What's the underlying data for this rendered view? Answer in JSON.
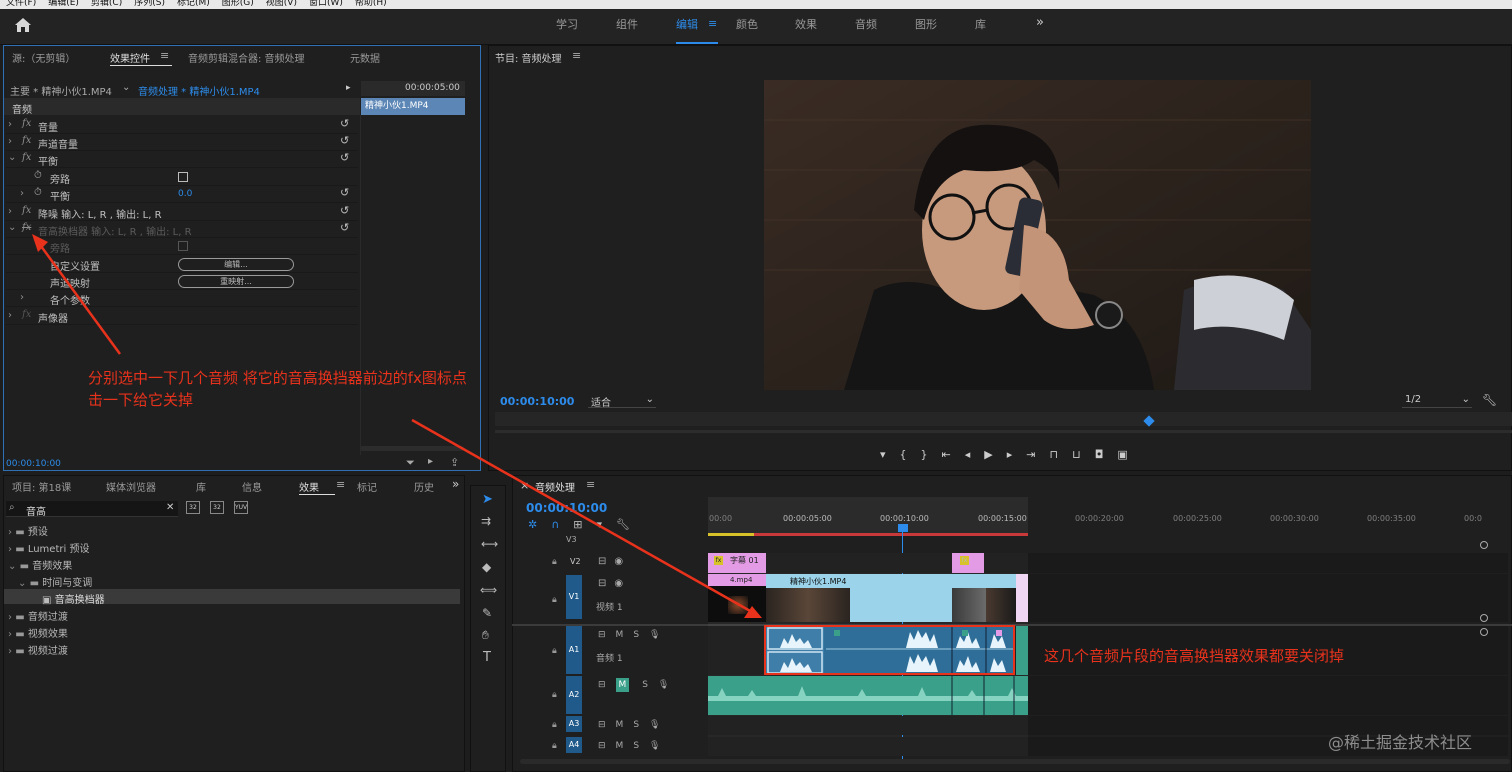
{
  "menu": [
    "文件(F)",
    "编辑(E)",
    "剪辑(C)",
    "序列(S)",
    "标记(M)",
    "图形(G)",
    "视图(V)",
    "窗口(W)",
    "帮助(H)"
  ],
  "workspaces": [
    "学习",
    "组件",
    "编辑",
    "颜色",
    "效果",
    "音频",
    "图形",
    "库"
  ],
  "active_workspace": "编辑",
  "source_panel": {
    "tabs": [
      "源:（无剪辑）",
      "效果控件",
      "音频剪辑混合器: 音频处理",
      "元数据"
    ],
    "clip_main": "主要 * 精神小伙1.MP4",
    "clip_seq": "音频处理 * 精神小伙1.MP4",
    "mini_time": "00:00:05:00",
    "mini_clip": "精神小伙1.MP4",
    "section": "音频",
    "rows": [
      {
        "fx": true,
        "label": "音量"
      },
      {
        "fx": true,
        "label": "声道音量"
      },
      {
        "fx": true,
        "label": "平衡"
      },
      {
        "label": "旁路"
      },
      {
        "label": "平衡",
        "value": "0.0"
      },
      {
        "fx": true,
        "label": "降噪 输入: L, R , 输出: L, R"
      },
      {
        "fx": true,
        "label": "音高换档器 输入: L, R , 输出: L, R"
      },
      {
        "label": "旁路"
      },
      {
        "label": "自定义设置",
        "button": "编辑..."
      },
      {
        "label": "声道映射",
        "button": "重映射..."
      },
      {
        "label": "各个参数"
      },
      {
        "fx": true,
        "label": "声像器"
      }
    ],
    "footer_time": "00:00:10:00"
  },
  "annotation1": "分别选中一下几个音频 将它的音高换挡器前边的fx图标点击一下给它关掉",
  "annotation2": "这几个音频片段的音高换挡器效果都要关闭掉",
  "program": {
    "title": "节目: 音频处理",
    "time": "00:00:10:00",
    "fit": "适合",
    "quality": "1/2"
  },
  "project": {
    "tabs": [
      "项目: 第18课",
      "媒体浏览器",
      "库",
      "信息",
      "效果",
      "标记",
      "历史"
    ],
    "search": "音高",
    "tree": [
      {
        "label": "预设",
        "level": 0
      },
      {
        "label": "Lumetri 预设",
        "level": 0
      },
      {
        "label": "音频效果",
        "level": 0
      },
      {
        "label": "时间与变调",
        "level": 1
      },
      {
        "label": "音高换档器",
        "level": 2
      },
      {
        "label": "音频过渡",
        "level": 0
      },
      {
        "label": "视频效果",
        "level": 0
      },
      {
        "label": "视频过渡",
        "level": 0
      }
    ]
  },
  "timeline": {
    "title": "音频处理",
    "time": "00:00:10:00",
    "ruler": [
      "00:00",
      "00:00:05:00",
      "00:00:10:00",
      "00:00:15:00",
      "00:00:20:00",
      "00:00:25:00",
      "00:00:30:00",
      "00:00:35:00",
      "00:0"
    ],
    "tracks": [
      "V3",
      "V2",
      "V1",
      "A1",
      "A2",
      "A3",
      "A4"
    ],
    "v1_name": "视频 1",
    "a1_name": "音频 1",
    "clip_title": "字幕 01",
    "clip_v1": "精神小伙1.MP4",
    "clip_v1b": "4.mp4"
  },
  "watermark": "@稀土掘金技术社区",
  "colors": {
    "accent": "#2d8ceb",
    "annotation": "#e8321c",
    "clip_video": "#9ad3ea",
    "clip_audio": "#3aa089",
    "clip_title": "#e39be6"
  }
}
